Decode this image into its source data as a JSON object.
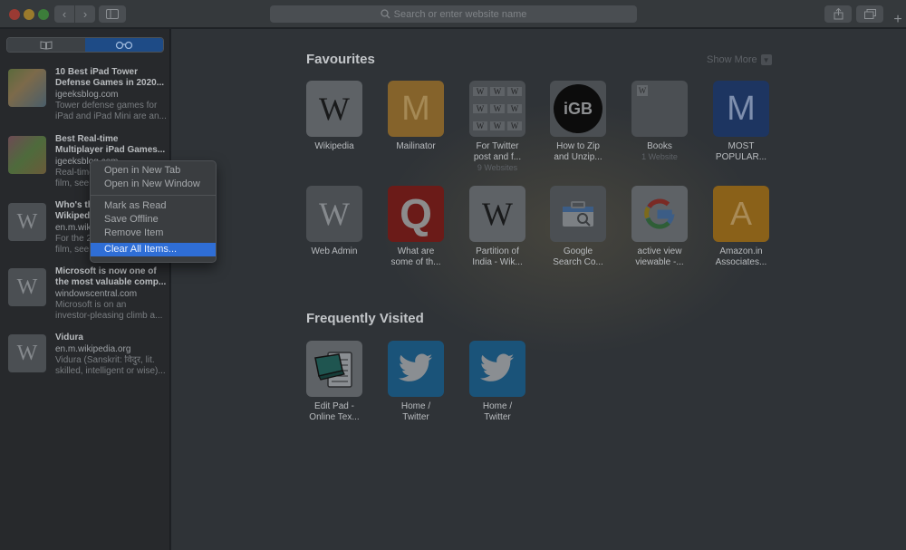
{
  "toolbar": {
    "back": "‹",
    "forward": "›",
    "address_placeholder": "Search or enter website name",
    "new_tab": "+"
  },
  "sidebar": {
    "reading_list": [
      {
        "title1": "10 Best iPad Tower",
        "title2": "Defense Games in 2020...",
        "domain": "igeeksblog.com",
        "desc1": "Tower defense games for",
        "desc2": "iPad and iPad Mini are an...",
        "thumb": "image"
      },
      {
        "title1": "Best Real-time",
        "title2": "Multiplayer iPad Games...",
        "domain": "igeeksblog.com",
        "desc1": "Real-time multiplayer",
        "desc2": "film, seen...",
        "thumb": "image"
      },
      {
        "title1": "Who's the",
        "title2": "Wikipedia...",
        "domain": "en.m.wiki...",
        "desc1": "For the 2...",
        "desc2": "film, seen...",
        "thumb": "W"
      },
      {
        "title1": "Microsoft is now one of",
        "title2": "the most valuable comp...",
        "domain": "windowscentral.com",
        "desc1": "Microsoft is on an",
        "desc2": "investor-pleasing climb a...",
        "thumb": "W"
      },
      {
        "title1": "Vidura",
        "title2": "",
        "domain": "en.m.wikipedia.org",
        "desc1": "Vidura (Sanskrit: विदुर, lit.",
        "desc2": "skilled, intelligent or wise)...",
        "thumb": "W"
      }
    ]
  },
  "context_menu": {
    "items": [
      "Open in New Tab",
      "Open in New Window",
      "Mark as Read",
      "Save Offline",
      "Remove Item",
      "Clear All Items..."
    ]
  },
  "main": {
    "favourites_title": "Favourites",
    "show_more": "Show More",
    "frequent_title": "Frequently Visited",
    "favourites": [
      {
        "l1": "Wikipedia",
        "l2": "",
        "sub": "",
        "glyph": "W"
      },
      {
        "l1": "Mailinator",
        "l2": "",
        "sub": "",
        "glyph": "M"
      },
      {
        "l1": "For Twitter",
        "l2": "post and f...",
        "sub": "9 Websites",
        "glyph": "W"
      },
      {
        "l1": "How to Zip",
        "l2": "and Unzip...",
        "sub": "",
        "glyph": "iGB"
      },
      {
        "l1": "Books",
        "l2": "",
        "sub": "1 Website",
        "glyph": "W"
      },
      {
        "l1": "MOST",
        "l2": "POPULAR...",
        "sub": "",
        "glyph": "M"
      },
      {
        "l1": "Web Admin",
        "l2": "",
        "sub": "",
        "glyph": "W"
      },
      {
        "l1": "What are",
        "l2": "some of th...",
        "sub": "",
        "glyph": "Q"
      },
      {
        "l1": "Partition of",
        "l2": "India - Wik...",
        "sub": "",
        "glyph": "W"
      },
      {
        "l1": "Google",
        "l2": "Search Co...",
        "sub": "",
        "glyph": ""
      },
      {
        "l1": "active view",
        "l2": "viewable -...",
        "sub": "",
        "glyph": "G"
      },
      {
        "l1": "Amazon.in",
        "l2": "Associates...",
        "sub": "",
        "glyph": "A"
      }
    ],
    "frequent": [
      {
        "l1": "Edit Pad -",
        "l2": "Online Tex..."
      },
      {
        "l1": "Home /",
        "l2": "Twitter"
      },
      {
        "l1": "Home /",
        "l2": "Twitter"
      }
    ]
  },
  "colors": {
    "accent": "#2f6ed6",
    "toolbar": "#35393c",
    "sidebar": "#27292c",
    "main": "#2f3337"
  }
}
